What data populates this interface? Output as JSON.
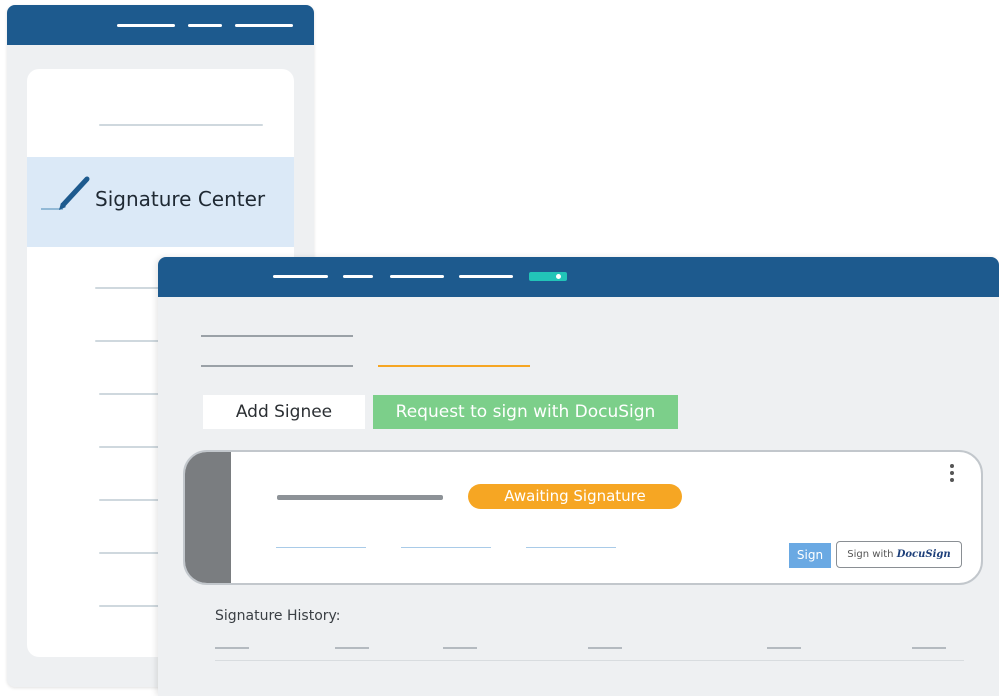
{
  "back_window": {
    "nav_item_label": "Signature Center",
    "icon": "pen-icon"
  },
  "front_window": {
    "actions": {
      "add_signee_label": "Add Signee",
      "docusign_request_label": "Request to sign with DocuSign"
    },
    "signature_card": {
      "status_badge": "Awaiting Signature",
      "sign_button_label": "Sign",
      "sign_with_prefix": "Sign with",
      "sign_with_brand": "DocuSign",
      "menu_icon": "kebab-menu-icon"
    },
    "history": {
      "label": "Signature History:"
    }
  },
  "colors": {
    "header_blue": "#1d5a8e",
    "selected_row": "#dbe9f7",
    "docusign_green": "#7ccf8a",
    "awaiting_orange": "#f6a623",
    "sign_blue": "#6aa9e3",
    "active_underline": "#f6a623"
  }
}
